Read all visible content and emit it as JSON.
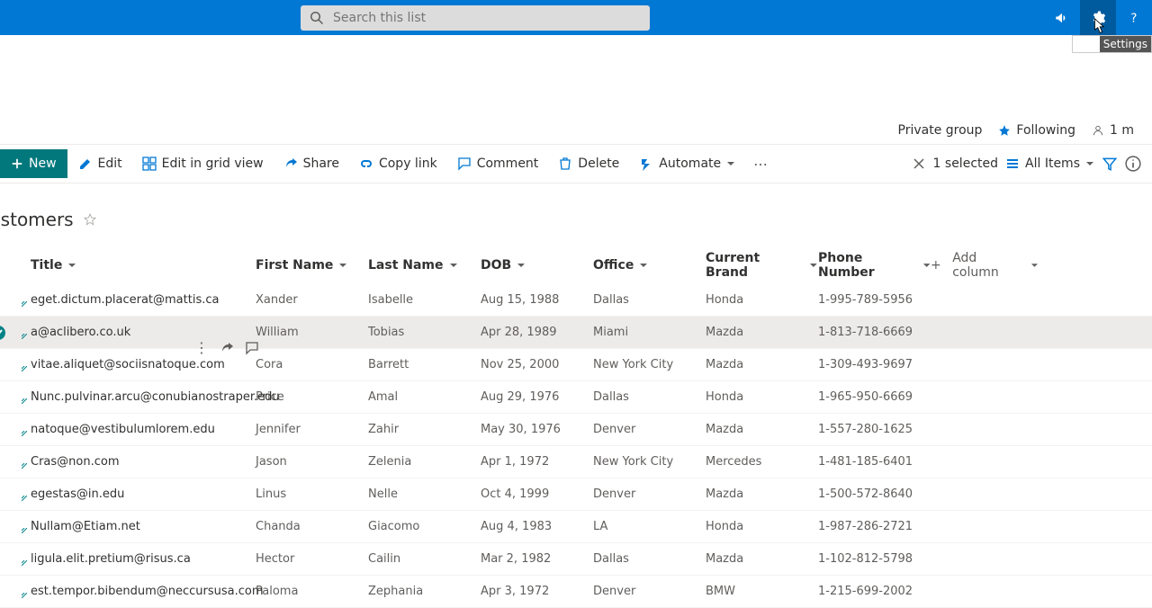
{
  "header": {
    "search_placeholder": "Search this list",
    "tooltip": "Settings"
  },
  "site": {
    "group_type": "Private group",
    "following": "Following",
    "members": "1 m"
  },
  "commands": {
    "new": "New",
    "edit": "Edit",
    "grid": "Edit in grid view",
    "share": "Share",
    "copy": "Copy link",
    "comment": "Comment",
    "delete": "Delete",
    "automate": "Automate",
    "selected": "1 selected",
    "view": "All Items"
  },
  "list": {
    "title": "ustomers"
  },
  "columns": {
    "title": "Title",
    "fn": "First Name",
    "ln": "Last Name",
    "dob": "DOB",
    "office": "Office",
    "brand": "Current Brand",
    "phone": "Phone Number",
    "add": "Add column"
  },
  "rows": [
    {
      "title": "eget.dictum.placerat@mattis.ca",
      "fn": "Xander",
      "ln": "Isabelle",
      "dob": "Aug 15, 1988",
      "office": "Dallas",
      "brand": "Honda",
      "phone": "1-995-789-5956",
      "selected": false
    },
    {
      "title": "a@aclibero.co.uk",
      "fn": "William",
      "ln": "Tobias",
      "dob": "Apr 28, 1989",
      "office": "Miami",
      "brand": "Mazda",
      "phone": "1-813-718-6669",
      "selected": true
    },
    {
      "title": "vitae.aliquet@sociisnatoque.com",
      "fn": "Cora",
      "ln": "Barrett",
      "dob": "Nov 25, 2000",
      "office": "New York City",
      "brand": "Mazda",
      "phone": "1-309-493-9697",
      "selected": false
    },
    {
      "title": "Nunc.pulvinar.arcu@conubianostraper.edu",
      "fn": "Price",
      "ln": "Amal",
      "dob": "Aug 29, 1976",
      "office": "Dallas",
      "brand": "Honda",
      "phone": "1-965-950-6669",
      "selected": false
    },
    {
      "title": "natoque@vestibulumlorem.edu",
      "fn": "Jennifer",
      "ln": "Zahir",
      "dob": "May 30, 1976",
      "office": "Denver",
      "brand": "Mazda",
      "phone": "1-557-280-1625",
      "selected": false
    },
    {
      "title": "Cras@non.com",
      "fn": "Jason",
      "ln": "Zelenia",
      "dob": "Apr 1, 1972",
      "office": "New York City",
      "brand": "Mercedes",
      "phone": "1-481-185-6401",
      "selected": false
    },
    {
      "title": "egestas@in.edu",
      "fn": "Linus",
      "ln": "Nelle",
      "dob": "Oct 4, 1999",
      "office": "Denver",
      "brand": "Mazda",
      "phone": "1-500-572-8640",
      "selected": false
    },
    {
      "title": "Nullam@Etiam.net",
      "fn": "Chanda",
      "ln": "Giacomo",
      "dob": "Aug 4, 1983",
      "office": "LA",
      "brand": "Honda",
      "phone": "1-987-286-2721",
      "selected": false
    },
    {
      "title": "ligula.elit.pretium@risus.ca",
      "fn": "Hector",
      "ln": "Cailin",
      "dob": "Mar 2, 1982",
      "office": "Dallas",
      "brand": "Mazda",
      "phone": "1-102-812-5798",
      "selected": false
    },
    {
      "title": "est.tempor.bibendum@neccursusa.com",
      "fn": "Paloma",
      "ln": "Zephania",
      "dob": "Apr 3, 1972",
      "office": "Denver",
      "brand": "BMW",
      "phone": "1-215-699-2002",
      "selected": false
    }
  ]
}
